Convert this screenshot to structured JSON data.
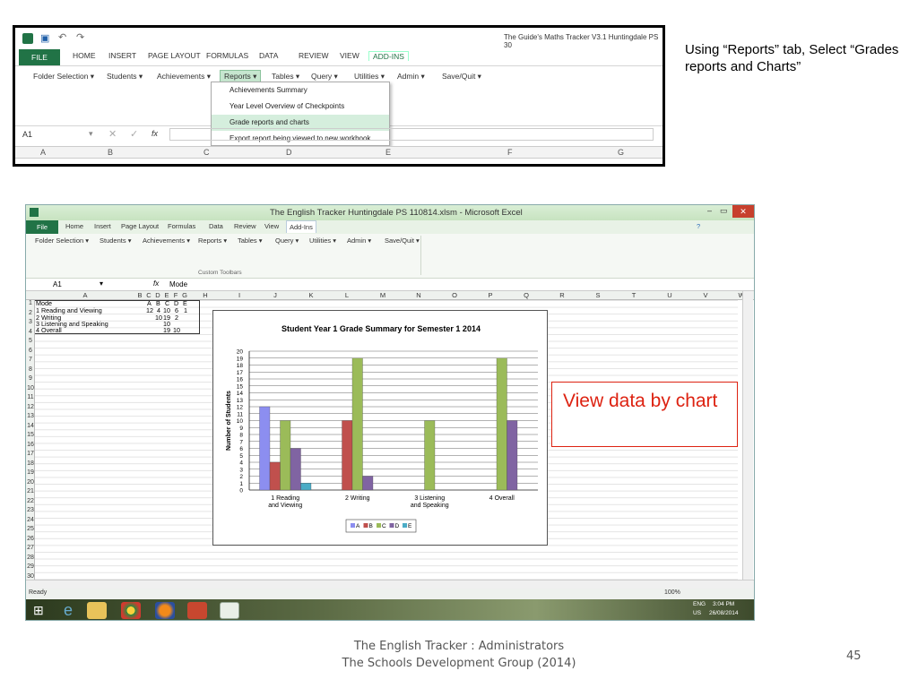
{
  "top_screenshot": {
    "title": "The Guide's Maths Tracker V3.1 Huntingdale PS 30",
    "tabs": [
      "FILE",
      "HOME",
      "INSERT",
      "PAGE LAYOUT",
      "FORMULAS",
      "DATA",
      "REVIEW",
      "VIEW",
      "ADD-INS"
    ],
    "ribbon_items": [
      "Folder Selection ▾",
      "Students ▾",
      "Achievements ▾",
      "Reports ▾",
      "Tables ▾",
      "Query ▾",
      "Utilities ▾",
      "Admin ▾",
      "Save/Quit ▾"
    ],
    "menu_items": [
      "Achievements Summary",
      "Year Level Overview of Checkpoints",
      "Grade reports and charts",
      "Export report being viewed to new workbook"
    ],
    "name_box": "A1",
    "fx": "fx",
    "columns": [
      "A",
      "B",
      "C",
      "D",
      "E",
      "F",
      "G"
    ]
  },
  "caption": "Using “Reports” tab, Select “Grades reports and Charts”",
  "main_window": {
    "title": "The English Tracker Huntingdale PS 110814.xlsm - Microsoft Excel",
    "tabs": [
      "File",
      "Home",
      "Insert",
      "Page Layout",
      "Formulas",
      "Data",
      "Review",
      "View",
      "Add-Ins"
    ],
    "ribbon_items": [
      "Folder Selection ▾",
      "Students ▾",
      "Achievements ▾",
      "Reports ▾",
      "Tables ▾",
      "Query ▾",
      "Utilities ▾",
      "Admin ▾",
      "Save/Quit ▾"
    ],
    "group_label": "Custom Toolbars",
    "name_box": "A1",
    "formula": "Mode",
    "columns": [
      "A",
      "B",
      "C",
      "D",
      "E",
      "F",
      "G",
      "H",
      "I",
      "J",
      "K",
      "L",
      "M",
      "N",
      "O",
      "P",
      "Q",
      "R",
      "S",
      "T",
      "U",
      "V",
      "W"
    ],
    "rows": [
      "1",
      "2",
      "3",
      "4",
      "5",
      "6",
      "7",
      "8",
      "9",
      "10",
      "11",
      "12",
      "13",
      "14",
      "15",
      "16",
      "17",
      "18",
      "19",
      "20",
      "21",
      "22",
      "23",
      "24",
      "25",
      "26",
      "27",
      "28",
      "29",
      "30"
    ],
    "table": {
      "header": [
        "Mode",
        "A",
        "B",
        "C",
        "D",
        "E"
      ],
      "rows": [
        [
          "1 Reading and Viewing",
          "12",
          "4",
          "10",
          "6",
          "1"
        ],
        [
          "2 Writing",
          "",
          "10",
          "19",
          "2",
          ""
        ],
        [
          "3 Listening and Speaking",
          "",
          "",
          "10",
          "",
          ""
        ],
        [
          "4 Overall",
          "",
          "",
          "19",
          "10",
          ""
        ]
      ]
    },
    "status": "Ready",
    "zoom": "100%",
    "tray": {
      "lang": "ENG",
      "region": "US",
      "time": "3:04 PM",
      "date": "26/08/2014"
    }
  },
  "callout": "View data by chart",
  "footer": {
    "line1": "The English Tracker :   Administrators",
    "line2": "The Schools Development Group  (2014)"
  },
  "page_number": "45",
  "chart_data": {
    "type": "bar",
    "title": "Student Year 1 Grade Summary for Semester 1 2014",
    "ylabel": "Number of Students",
    "xlabel": "",
    "ylim": [
      0,
      20
    ],
    "categories": [
      "1 Reading and Viewing",
      "2 Writing",
      "3 Listening and Speaking",
      "4 Overall"
    ],
    "series": [
      {
        "name": "A",
        "color": "#8c8ef0",
        "values": [
          12,
          0,
          0,
          0
        ]
      },
      {
        "name": "B",
        "color": "#c0504d",
        "values": [
          4,
          10,
          0,
          0
        ]
      },
      {
        "name": "C",
        "color": "#9bbb59",
        "values": [
          10,
          19,
          10,
          19
        ]
      },
      {
        "name": "D",
        "color": "#8064a2",
        "values": [
          6,
          2,
          0,
          10
        ]
      },
      {
        "name": "E",
        "color": "#4bacc6",
        "values": [
          1,
          0,
          0,
          0
        ]
      }
    ],
    "legend": "bottom"
  }
}
